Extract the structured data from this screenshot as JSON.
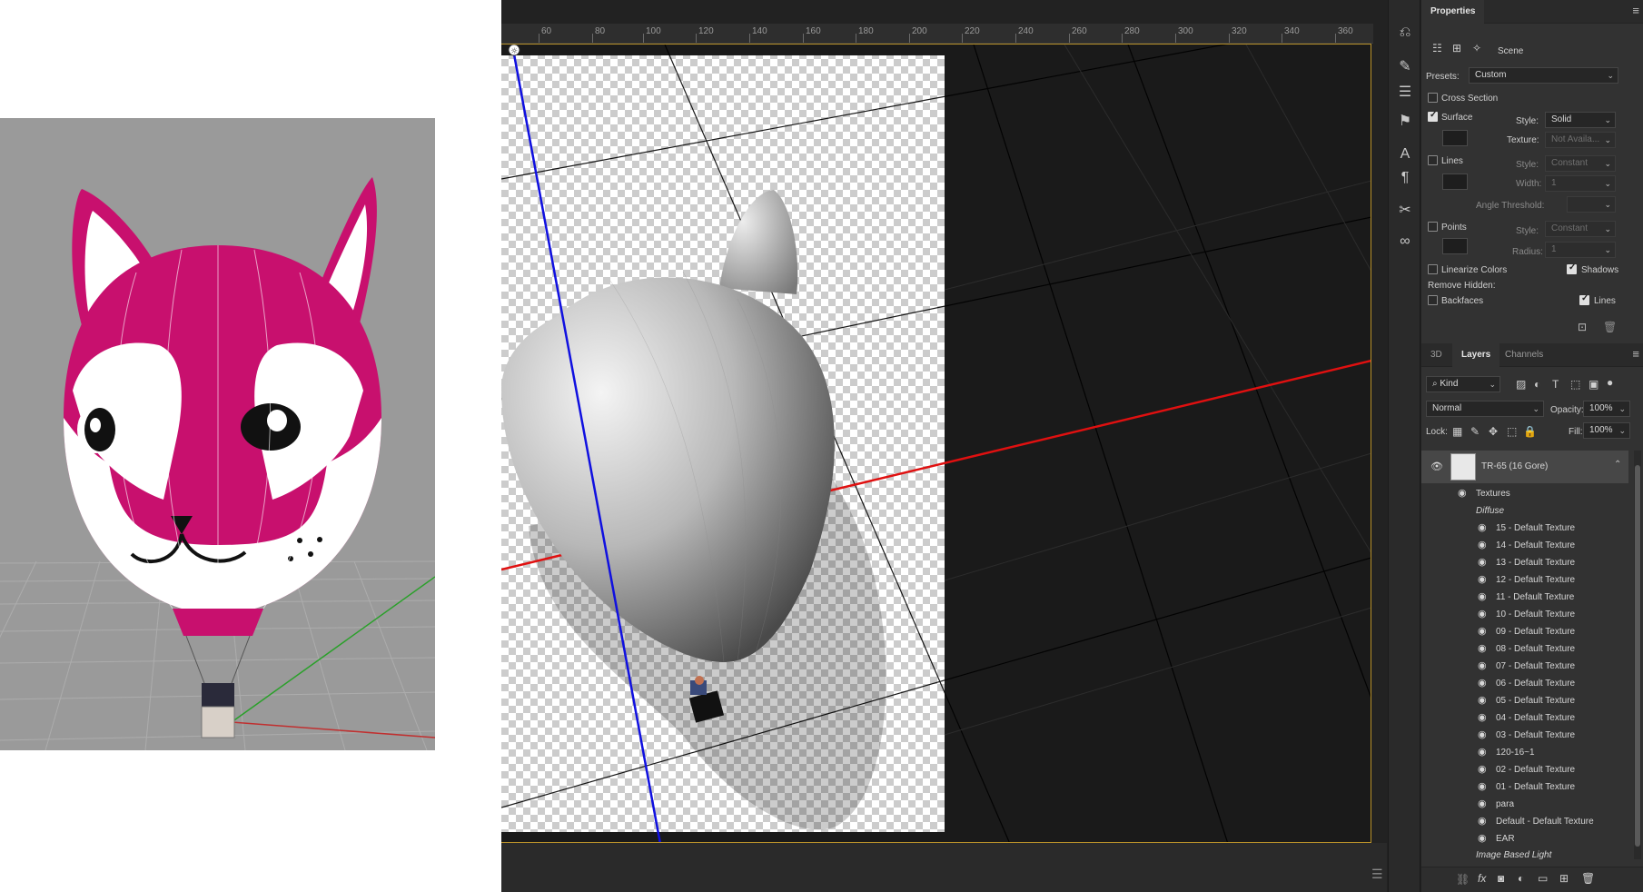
{
  "ruler": {
    "labels": [
      "60",
      "80",
      "100",
      "120",
      "140",
      "160",
      "180",
      "200",
      "220",
      "240",
      "260",
      "280",
      "300",
      "320",
      "340",
      "360"
    ]
  },
  "properties": {
    "tab": "Properties",
    "mode_label": "Scene",
    "presets_label": "Presets:",
    "presets_value": "Custom",
    "cross_section_label": "Cross Section",
    "surface_label": "Surface",
    "surface_style_label": "Style:",
    "surface_style_value": "Solid",
    "surface_texture_label": "Texture:",
    "surface_texture_value": "Not Availa...",
    "lines_label": "Lines",
    "lines_style_label": "Style:",
    "lines_style_value": "Constant",
    "lines_width_label": "Width:",
    "lines_width_value": "1",
    "angle_threshold_label": "Angle Threshold:",
    "points_label": "Points",
    "points_style_label": "Style:",
    "points_style_value": "Constant",
    "points_radius_label": "Radius:",
    "points_radius_value": "1",
    "linearize_label": "Linearize Colors",
    "shadows_label": "Shadows",
    "remove_hidden_label": "Remove Hidden:",
    "backfaces_label": "Backfaces",
    "lines2_label": "Lines"
  },
  "layers_panel": {
    "tabs": [
      "3D",
      "Layers",
      "Channels"
    ],
    "active_tab": "Layers",
    "filter_value": "Kind",
    "blend_value": "Normal",
    "opacity_label": "Opacity:",
    "opacity_value": "100%",
    "lock_label": "Lock:",
    "fill_label": "Fill:",
    "fill_value": "100%",
    "layer_name": "TR-65 (16 Gore)",
    "textures_label": "Textures",
    "diffuse_label": "Diffuse",
    "textures": [
      "15 - Default Texture",
      "14 - Default Texture",
      "13 - Default Texture",
      "12 - Default Texture",
      "11 - Default Texture",
      "10 - Default Texture",
      "09 - Default Texture",
      "08 - Default Texture",
      "07 - Default Texture",
      "06 - Default Texture",
      "05 - Default Texture",
      "04 - Default Texture",
      "03 - Default Texture",
      "120-16~1",
      "02 - Default Texture",
      "01 - Default Texture",
      "para",
      "Default - Default Texture",
      "EAR"
    ],
    "ibl_label": "Image Based Light"
  },
  "colors": {
    "accent_border": "#b8912a",
    "balloon_magenta": "#c8106e",
    "axis_red": "#e01010",
    "axis_blue": "#1010e0",
    "axis_green": "#20a020"
  }
}
